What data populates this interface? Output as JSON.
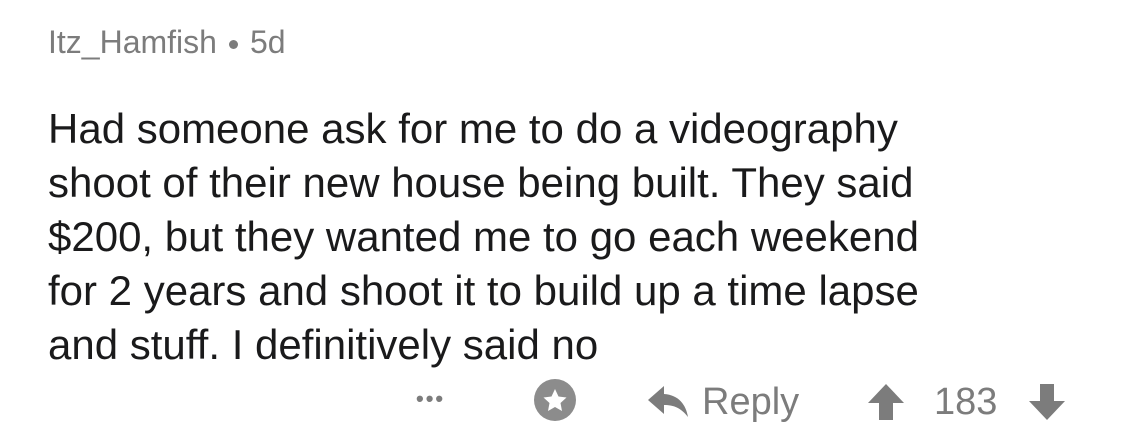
{
  "comment": {
    "author": "Itz_Hamfish",
    "age": "5d",
    "body": "Had someone ask for me to do a videography\nshoot of their new house being built. They said\n$200, but they wanted me to go each weekend\nfor 2 years and shoot it to build up a time lapse\nand stuff. I definitively said no"
  },
  "actions": {
    "more_label": "•••",
    "reply_label": "Reply",
    "score": "183"
  },
  "icons": {
    "more": "more-options-icon",
    "award": "award-icon",
    "reply": "reply-arrow-icon",
    "upvote": "upvote-arrow-icon",
    "downvote": "downvote-arrow-icon"
  },
  "colors": {
    "text": "#1a1a1b",
    "meta": "#7c7c7c"
  }
}
